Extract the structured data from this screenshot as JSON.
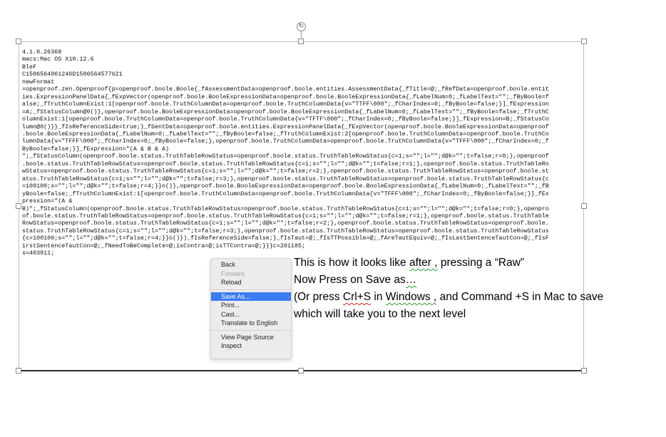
{
  "rotate_icon": "rotate-arrow-icon",
  "raw_lines": [
    "4.1.0.26369",
    "macs:Mac OS X10.12.6",
    "BleF",
    "C1506564061246D1506564577621",
    "newFormat",
    "=openproof.zen.Openproof{p=openproof.boole.Boole{_fAssessmentData=openproof.boole.entities.AssessmentData{_fTitle=@;_fRefData=openproof.boole.entit",
    "ies.ExpressionPanelData{_fExpVector(openproof.boole.BooleExpressionData=openproof.boole.BooleExpressionData{_fLabelNum=0;_fLabelText=\"\";_fByBoole=f",
    "alse;_fTruthColumnExist:1[openproof.boole.TruthColumnData=openproof.boole.TruthColumnData{v=\"TTFF\\000\";_fCharIndex=0;_fByBoole=false;}]_fExpression",
    "=A;_fStatusColumn@0()},openproof.boole.BooleExpressionData=openproof.boole.BooleExpressionData{_fLabelNum=0;_fLabelText=\"\";_fByBoole=false;_fTruthC",
    "olumnExist:1[openproof.boole.TruthColumnData=openproof.boole.TruthColumnData{v=\"TFTF\\000\";_fCharIndex=0;_fByBoole=false;}]_fExpression=B;_fStatusCo",
    "lumn@0()}}_fIsReferenceSide=true;}_fSentData=openproof.boole.entities.ExpressionPanelData{_fExpVector(openproof.boole.BooleExpressionData=openproof",
    ".boole.BooleExpressionData{_fLabelNum=0;_fLabelText=\"\";_fByBoole=false;_fTruthColumnExist:2[openproof.boole.TruthColumnData=openproof.boole.TruthCo",
    "lumnData{v=\"TFFF\\000\";_fCharIndex=0;_fByBoole=false;},openproof.boole.TruthColumnData=openproof.boole.TruthColumnData{v=\"TFFF\\000\";_fCharIndex=0;_f",
    "ByBoole=false;}]_fExpression=\"(A & B & A)",
    "\";_fStatusColumn(openproof.boole.status.TruthTableRowStatus=openproof.boole.status.TruthTableRowStatus{c=1;s=\"\";l=\"\";d@k=\"\";t=false;r=0;},openproof",
    ".boole.status.TruthTableRowStatus=openproof.boole.status.TruthTableRowStatus{c=1;s=\"\";l=\"\";d@k=\"\";t=false;r=1;},openproof.boole.status.TruthTableRo",
    "wStatus=openproof.boole.status.TruthTableRowStatus{c=1;s=\"\";l=\"\";d@k=\"\";t=false;r=2;},openproof.boole.status.TruthTableRowStatus=openproof.boole.st",
    "atus.TruthTableRowStatus{c=1;s=\"\";l=\"\";d@k=\"\";t=false;r=3;},openproof.boole.status.TruthTableRowStatus=openproof.boole.status.TruthTableRowStatus{c",
    "=100100;s=\"\";l=\"\";d@k=\"\";t=false;r=4;}}o()},openproof.boole.BooleExpressionData=openproof.boole.BooleExpressionData{_fLabelNum=0;_fLabelText=\"\";_fB",
    "yBoole=false;_fTruthColumnExist:1[openproof.boole.TruthColumnData=openproof.boole.TruthColumnData{v=\"TFFF\\000\";_fCharIndex=0;_fByBoole=false;}]_fEx",
    "pression=\"(A &",
    "B)\";_fStatusColumn(openproof.boole.status.TruthTableRowStatus=openproof.boole.status.TruthTableRowStatus{c=1;s=\"\";l=\"\";d@k=\"\";t=false;r=0;},openpro",
    "of.boole.status.TruthTableRowStatus=openproof.boole.status.TruthTableRowStatus{c=1;s=\"\";l=\"\";d@k=\"\";t=false;r=1;},openproof.boole.status.TruthTable",
    "RowStatus=openproof.boole.status.TruthTableRowStatus{c=1;s=\"\";l=\"\";d@k=\"\";t=false;r=2;},openproof.boole.status.TruthTableRowStatus=openproof.boole.",
    "status.TruthTableRowStatus{c=1;s=\"\";l=\"\";d@k=\"\";t=false;r=3;},openproof.boole.status.TruthTableRowStatus=openproof.boole.status.TruthTableRowStatus",
    "{c=100100;s=\"\";l=\"\";d@k=\"\";t=false;r=4;}}o()})_fIsReferenceSide=false;}_fIsTaut=@;_fIsTTPossible=@;_fAreTautEquiv=@;_fIsLastSentenceTautCon=@;_fIsF",
    "irstSentenceTautCon=@;_fNeedToBeComplete=@;isContra=@;isTTContra=@;}}}c=281185;",
    "s=403811;"
  ],
  "context_menu": {
    "items": [
      {
        "label": "Back",
        "disabled": false,
        "highlighted": false,
        "sep_after": false
      },
      {
        "label": "Forward",
        "disabled": true,
        "highlighted": false,
        "sep_after": false
      },
      {
        "label": "Reload",
        "disabled": false,
        "highlighted": false,
        "sep_after": true
      },
      {
        "label": "Save As...",
        "disabled": false,
        "highlighted": true,
        "sep_after": false
      },
      {
        "label": "Print...",
        "disabled": false,
        "highlighted": false,
        "sep_after": false
      },
      {
        "label": "Cast...",
        "disabled": false,
        "highlighted": false,
        "sep_after": false
      },
      {
        "label": "Translate to English",
        "disabled": false,
        "highlighted": false,
        "sep_after": true
      },
      {
        "label": "View Page Source",
        "disabled": false,
        "highlighted": false,
        "sep_after": false
      },
      {
        "label": "Inspect",
        "disabled": false,
        "highlighted": false,
        "sep_after": false
      }
    ]
  },
  "instructions": {
    "line1_a": "This is how it looks like ",
    "line1_b": "after ,",
    "line1_c": " pressing a “Raw”",
    "line2_a": "Now Press on Save as",
    "line2_b": "…",
    "line3_a": "(Or press ",
    "line3_b": "Crl+S",
    "line3_c": " in ",
    "line3_d": "Windows ,",
    "line3_e": " and Command +S in Mac to save",
    "line4": "which will take you to the next level"
  },
  "colors": {
    "highlight": "#3b7cf0",
    "spell_red": "#e2231a",
    "grammar_green": "#2e9d3a"
  }
}
